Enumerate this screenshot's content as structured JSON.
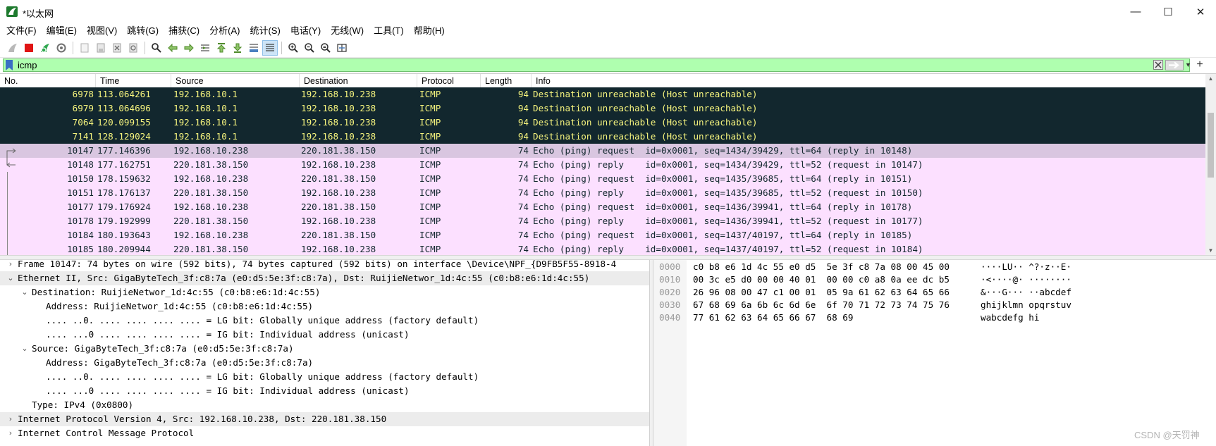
{
  "window": {
    "title": "*以太网",
    "minimize": "—",
    "maximize": "☐",
    "close": "✕"
  },
  "menu": [
    "文件(F)",
    "编辑(E)",
    "视图(V)",
    "跳转(G)",
    "捕获(C)",
    "分析(A)",
    "统计(S)",
    "电话(Y)",
    "无线(W)",
    "工具(T)",
    "帮助(H)"
  ],
  "toolbar": {
    "icons": [
      "shark-fin-start-icon",
      "stop-capture-icon",
      "restart-capture-icon",
      "capture-options-icon",
      "open-file-icon",
      "save-file-icon",
      "close-file-icon",
      "reload-file-icon",
      "find-packet-icon",
      "go-back-icon",
      "go-forward-icon",
      "go-to-packet-icon",
      "go-first-icon",
      "go-last-icon",
      "autoscroll-icon",
      "colorize-icon",
      "zoom-in-icon",
      "zoom-out-icon",
      "zoom-normal-icon",
      "resize-columns-icon"
    ]
  },
  "filter": {
    "value": "icmp",
    "add_label": "+",
    "bg_color": "#afffaf"
  },
  "packet_list": {
    "columns": [
      "No.",
      "Time",
      "Source",
      "Destination",
      "Protocol",
      "Length",
      "Info"
    ],
    "rows": [
      {
        "no": "6978",
        "time": "113.064261",
        "src": "192.168.10.1",
        "dst": "192.168.10.238",
        "proto": "ICMP",
        "len": "94",
        "info": "Destination unreachable (Host unreachable)",
        "style": "dark"
      },
      {
        "no": "6979",
        "time": "113.064696",
        "src": "192.168.10.1",
        "dst": "192.168.10.238",
        "proto": "ICMP",
        "len": "94",
        "info": "Destination unreachable (Host unreachable)",
        "style": "dark"
      },
      {
        "no": "7064",
        "time": "120.099155",
        "src": "192.168.10.1",
        "dst": "192.168.10.238",
        "proto": "ICMP",
        "len": "94",
        "info": "Destination unreachable (Host unreachable)",
        "style": "dark"
      },
      {
        "no": "7141",
        "time": "128.129024",
        "src": "192.168.10.1",
        "dst": "192.168.10.238",
        "proto": "ICMP",
        "len": "94",
        "info": "Destination unreachable (Host unreachable)",
        "style": "dark"
      },
      {
        "no": "10147",
        "time": "177.146396",
        "src": "192.168.10.238",
        "dst": "220.181.38.150",
        "proto": "ICMP",
        "len": "74",
        "info": "Echo (ping) request  id=0x0001, seq=1434/39429, ttl=64 (reply in 10148)",
        "style": "selected"
      },
      {
        "no": "10148",
        "time": "177.162751",
        "src": "220.181.38.150",
        "dst": "192.168.10.238",
        "proto": "ICMP",
        "len": "74",
        "info": "Echo (ping) reply    id=0x0001, seq=1434/39429, ttl=52 (request in 10147)",
        "style": "pink"
      },
      {
        "no": "10150",
        "time": "178.159632",
        "src": "192.168.10.238",
        "dst": "220.181.38.150",
        "proto": "ICMP",
        "len": "74",
        "info": "Echo (ping) request  id=0x0001, seq=1435/39685, ttl=64 (reply in 10151)",
        "style": "pink"
      },
      {
        "no": "10151",
        "time": "178.176137",
        "src": "220.181.38.150",
        "dst": "192.168.10.238",
        "proto": "ICMP",
        "len": "74",
        "info": "Echo (ping) reply    id=0x0001, seq=1435/39685, ttl=52 (request in 10150)",
        "style": "pink"
      },
      {
        "no": "10177",
        "time": "179.176924",
        "src": "192.168.10.238",
        "dst": "220.181.38.150",
        "proto": "ICMP",
        "len": "74",
        "info": "Echo (ping) request  id=0x0001, seq=1436/39941, ttl=64 (reply in 10178)",
        "style": "pink"
      },
      {
        "no": "10178",
        "time": "179.192999",
        "src": "220.181.38.150",
        "dst": "192.168.10.238",
        "proto": "ICMP",
        "len": "74",
        "info": "Echo (ping) reply    id=0x0001, seq=1436/39941, ttl=52 (request in 10177)",
        "style": "pink"
      },
      {
        "no": "10184",
        "time": "180.193643",
        "src": "192.168.10.238",
        "dst": "220.181.38.150",
        "proto": "ICMP",
        "len": "74",
        "info": "Echo (ping) request  id=0x0001, seq=1437/40197, ttl=64 (reply in 10185)",
        "style": "pink"
      },
      {
        "no": "10185",
        "time": "180.209944",
        "src": "220.181.38.150",
        "dst": "192.168.10.238",
        "proto": "ICMP",
        "len": "74",
        "info": "Echo (ping) reply    id=0x0001, seq=1437/40197, ttl=52 (request in 10184)",
        "style": "pink"
      }
    ],
    "colors": {
      "dark_bg": "#12272e",
      "dark_fg": "#f7f57e",
      "pink_bg": "#fce0ff",
      "selected_bg": "#d9c6e0"
    }
  },
  "details": [
    {
      "text": "Frame 10147: 74 bytes on wire (592 bits), 74 bytes captured (592 bits) on interface \\Device\\NPF_{D9FB5F55-8918-4",
      "arrow": "›",
      "level": 0,
      "shaded": false
    },
    {
      "text": "Ethernet II, Src: GigaByteTech_3f:c8:7a (e0:d5:5e:3f:c8:7a), Dst: RuijieNetwor_1d:4c:55 (c0:b8:e6:1d:4c:55)",
      "arrow": "⌄",
      "level": 0,
      "shaded": true
    },
    {
      "text": "Destination: RuijieNetwor_1d:4c:55 (c0:b8:e6:1d:4c:55)",
      "arrow": "⌄",
      "level": 1,
      "shaded": false
    },
    {
      "text": "Address: RuijieNetwor_1d:4c:55 (c0:b8:e6:1d:4c:55)",
      "arrow": "",
      "level": 2,
      "shaded": false
    },
    {
      "text": ".... ..0. .... .... .... .... = LG bit: Globally unique address (factory default)",
      "arrow": "",
      "level": 2,
      "shaded": false
    },
    {
      "text": ".... ...0 .... .... .... .... = IG bit: Individual address (unicast)",
      "arrow": "",
      "level": 2,
      "shaded": false
    },
    {
      "text": "Source: GigaByteTech_3f:c8:7a (e0:d5:5e:3f:c8:7a)",
      "arrow": "⌄",
      "level": 1,
      "shaded": false
    },
    {
      "text": "Address: GigaByteTech_3f:c8:7a (e0:d5:5e:3f:c8:7a)",
      "arrow": "",
      "level": 2,
      "shaded": false
    },
    {
      "text": ".... ..0. .... .... .... .... = LG bit: Globally unique address (factory default)",
      "arrow": "",
      "level": 2,
      "shaded": false
    },
    {
      "text": ".... ...0 .... .... .... .... = IG bit: Individual address (unicast)",
      "arrow": "",
      "level": 2,
      "shaded": false
    },
    {
      "text": "Type: IPv4 (0x0800)",
      "arrow": "",
      "level": 1,
      "shaded": false
    },
    {
      "text": "Internet Protocol Version 4, Src: 192.168.10.238, Dst: 220.181.38.150",
      "arrow": "›",
      "level": 0,
      "shaded": true
    },
    {
      "text": "Internet Control Message Protocol",
      "arrow": "›",
      "level": 0,
      "shaded": false
    }
  ],
  "bytes": [
    {
      "offset": "0000",
      "hex": "c0 b8 e6 1d 4c 55 e0 d5  5e 3f c8 7a 08 00 45 00",
      "ascii": "····LU·· ^?·z··E·"
    },
    {
      "offset": "0010",
      "hex": "00 3c e5 d0 00 00 40 01  00 00 c0 a8 0a ee dc b5",
      "ascii": "·<····@· ········"
    },
    {
      "offset": "0020",
      "hex": "26 96 08 00 47 c1 00 01  05 9a 61 62 63 64 65 66",
      "ascii": "&···G··· ··abcdef"
    },
    {
      "offset": "0030",
      "hex": "67 68 69 6a 6b 6c 6d 6e  6f 70 71 72 73 74 75 76",
      "ascii": "ghijklmn opqrstuv"
    },
    {
      "offset": "0040",
      "hex": "77 61 62 63 64 65 66 67  68 69",
      "ascii": "wabcdefg hi"
    }
  ],
  "watermark": "CSDN @天罚神"
}
